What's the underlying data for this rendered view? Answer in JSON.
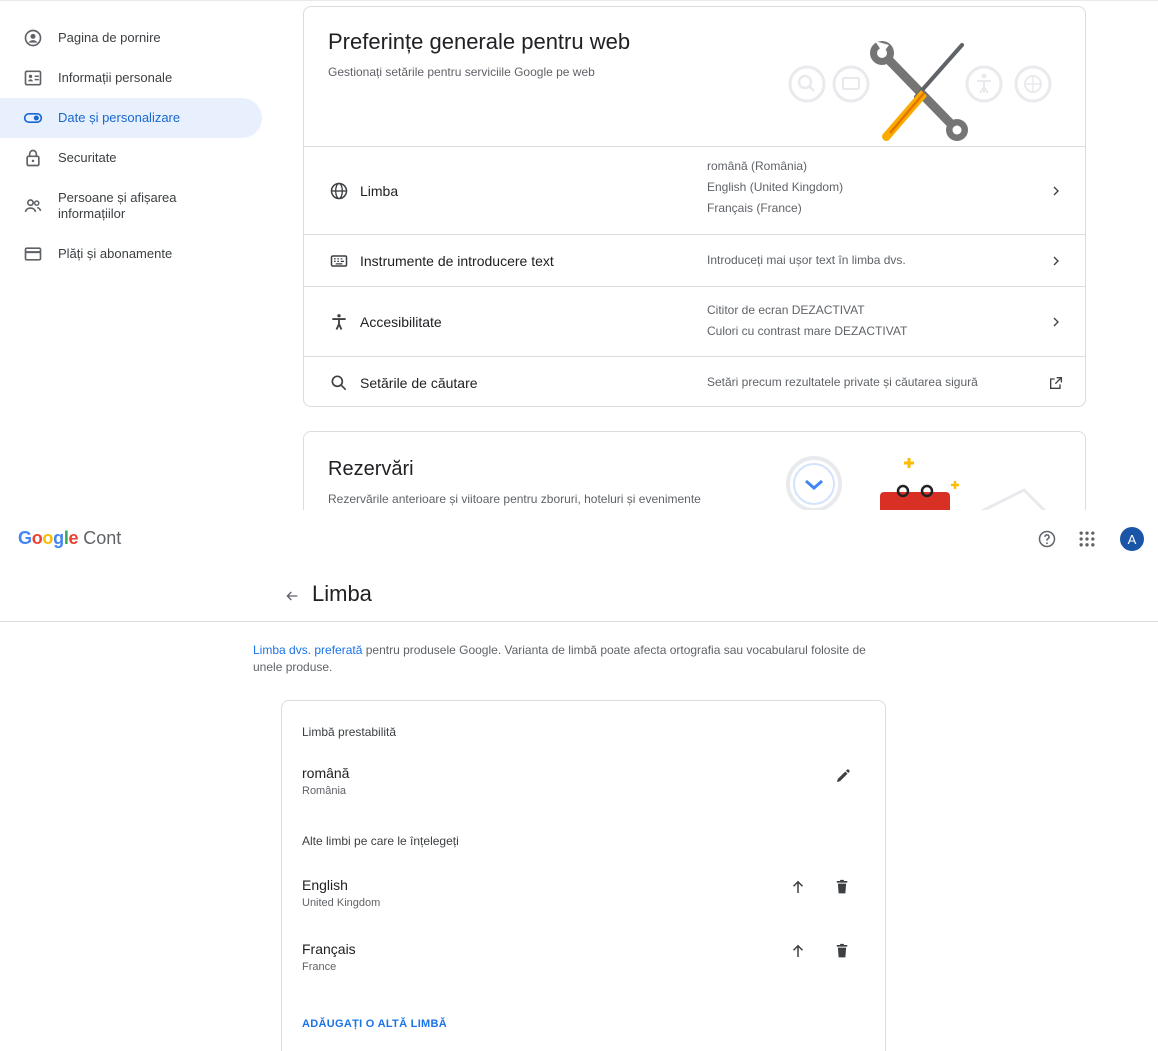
{
  "top": {
    "nav": [
      {
        "label": "Pagina de pornire",
        "icon": "home-icon"
      },
      {
        "label": "Informații personale",
        "icon": "id-card-icon"
      },
      {
        "label": "Date și personalizare",
        "icon": "toggle-icon",
        "active": true
      },
      {
        "label": "Securitate",
        "icon": "lock-icon"
      },
      {
        "label": "Persoane și afișarea informațiilor",
        "icon": "people-icon"
      },
      {
        "label": "Plăți și abonamente",
        "icon": "credit-card-icon"
      }
    ],
    "prefs_card": {
      "title": "Preferințe generale pentru web",
      "subtitle": "Gestionați setările pentru serviciile Google pe web",
      "rows": [
        {
          "label": "Limba",
          "icon": "globe-icon",
          "values": [
            "română (România)",
            "English (United Kingdom)",
            "Français (France)"
          ],
          "action": "chevron-right-icon"
        },
        {
          "label": "Instrumente de introducere text",
          "icon": "keyboard-icon",
          "values": [
            "Introduceți mai ușor text în limba dvs."
          ],
          "action": "chevron-right-icon"
        },
        {
          "label": "Accesibilitate",
          "icon": "accessibility-icon",
          "values": [
            "Cititor de ecran DEZACTIVAT",
            "Culori cu contrast mare DEZACTIVAT"
          ],
          "action": "chevron-right-icon"
        },
        {
          "label": "Setările de căutare",
          "icon": "search-icon",
          "values": [
            "Setări precum rezultatele private și căutarea sigură"
          ],
          "action": "open-external-icon"
        }
      ]
    },
    "reservations_card": {
      "title": "Rezervări",
      "subtitle": "Rezervările anterioare și viitoare pentru zboruri, hoteluri și evenimente"
    }
  },
  "bottom": {
    "header": {
      "logo": "Google",
      "product": "Cont",
      "avatar_letter": "A",
      "logo_colors": [
        "#4285F4",
        "#EA4335",
        "#FBBC05",
        "#4285F4",
        "#34A853",
        "#EA4335"
      ]
    },
    "page_title": "Limba",
    "intro": {
      "link_text": "Limba dvs. preferată",
      "text": " pentru produsele Google. Varianta de limbă poate afecta ortografia sau vocabularul folosite de unele produse."
    },
    "default_section": {
      "heading": "Limbă prestabilită",
      "language": {
        "name": "română",
        "region": "România"
      }
    },
    "other_section": {
      "heading": "Alte limbi pe care le înțelegeți",
      "languages": [
        {
          "name": "English",
          "region": "United Kingdom"
        },
        {
          "name": "Français",
          "region": "France"
        }
      ]
    },
    "add_language_label": "ADĂUGAȚI O ALTĂ LIMBĂ"
  },
  "colors": {
    "accent": "#1a73e8",
    "active_nav_bg": "#e8f0fe",
    "active_nav_text": "#1967d2",
    "avatar_bg": "#1a55a8"
  }
}
